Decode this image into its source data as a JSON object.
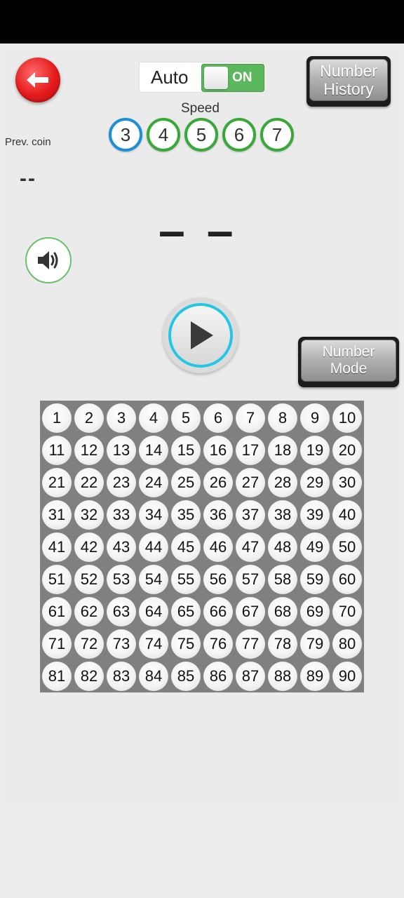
{
  "header": {
    "auto_label": "Auto",
    "toggle_state": "ON",
    "history_line1": "Number",
    "history_line2": "History"
  },
  "speed": {
    "title": "Speed",
    "options": [
      "3",
      "4",
      "5",
      "6",
      "7"
    ],
    "selected": "3"
  },
  "prev_coin": {
    "label": "Prev. coin",
    "value": "--"
  },
  "current": {
    "value": "– –"
  },
  "mode_button": {
    "line1": "Number",
    "line2": "Mode"
  },
  "board": {
    "numbers": [
      "1",
      "2",
      "3",
      "4",
      "5",
      "6",
      "7",
      "8",
      "9",
      "10",
      "11",
      "12",
      "13",
      "14",
      "15",
      "16",
      "17",
      "18",
      "19",
      "20",
      "21",
      "22",
      "23",
      "24",
      "25",
      "26",
      "27",
      "28",
      "29",
      "30",
      "31",
      "32",
      "33",
      "34",
      "35",
      "36",
      "37",
      "38",
      "39",
      "40",
      "41",
      "42",
      "43",
      "44",
      "45",
      "46",
      "47",
      "48",
      "49",
      "50",
      "51",
      "52",
      "53",
      "54",
      "55",
      "56",
      "57",
      "58",
      "59",
      "60",
      "61",
      "62",
      "63",
      "64",
      "65",
      "66",
      "67",
      "68",
      "69",
      "70",
      "71",
      "72",
      "73",
      "74",
      "75",
      "76",
      "77",
      "78",
      "79",
      "80",
      "81",
      "82",
      "83",
      "84",
      "85",
      "86",
      "87",
      "88",
      "89",
      "90"
    ]
  },
  "colors": {
    "back_button": "#e41b1b",
    "toggle_on": "#5cb85c",
    "speed_ring": "#39a839",
    "speed_active_ring": "#1e8fd6",
    "play_ring": "#23c6e3",
    "board_bg": "#808080"
  },
  "icons": {
    "back": "arrow-left-icon",
    "sound": "speaker-icon",
    "play": "play-icon"
  }
}
